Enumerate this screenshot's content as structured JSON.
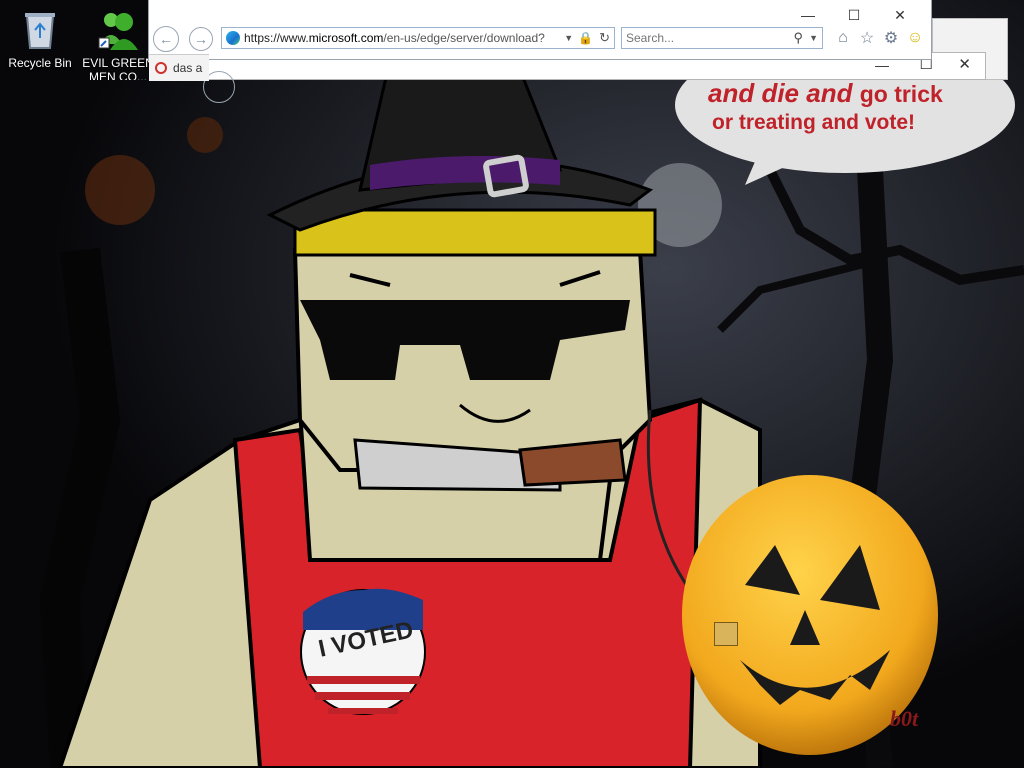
{
  "desktop": {
    "icons": [
      {
        "label": "Recycle Bin"
      },
      {
        "label": "EVIL GREEN MEN CO..."
      }
    ]
  },
  "browser": {
    "url_prefix": "https://www.",
    "url_domain": "microsoft.com",
    "url_path": "/en-us/edge/server/download?",
    "search_placeholder": "Search...",
    "tab_label": "das a",
    "window_controls": {
      "minimize": "—",
      "maximize": "☐",
      "close": "✕"
    }
  },
  "wallpaper": {
    "speech_text_line1_a": "and die and",
    "speech_text_line1_b": "go trick",
    "speech_text_line2": "or treating and vote!",
    "sticker_text": "I VOTED",
    "corner_mark": "b0t"
  },
  "colors": {
    "speech_red": "#c0222a",
    "shirt_red": "#d8232a",
    "skin": "#d6d0a8",
    "pumpkin": "#f2a81d"
  }
}
